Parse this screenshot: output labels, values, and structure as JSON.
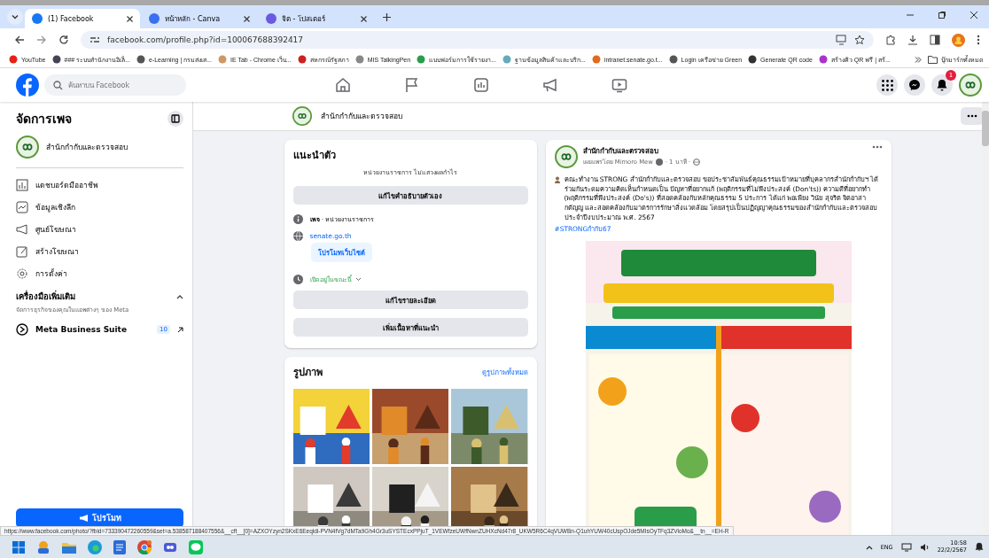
{
  "browser": {
    "tabs": [
      {
        "label": "(1) Facebook",
        "selected": true
      },
      {
        "label": "หน้าหลัก - Canva",
        "selected": false
      },
      {
        "label": "จิต - โปสเตอร์",
        "selected": false
      }
    ],
    "address": "facebook.com/profile.php?id=100067688392417",
    "bookmarks": [
      "YouTube",
      "### ระบบสำนักงานอิเล็...",
      "e-Learning | กรมส่งเส...",
      "IE Tab - Chrome เว็บ...",
      "สหกรณ์รัฐสภา",
      "MIS TalkingPen",
      "แบบฟอร์มการใช้รายงา...",
      "ฐานข้อมูลสินค้าและบริก...",
      "intranet.senate.go.t...",
      "Login เครือข่าย Green",
      "Generate QR code",
      "สร้างคิว QR ฟรี | สร้..."
    ],
    "all_bookmarks": "บุ๊กมาร์กทั้งหมด"
  },
  "header": {
    "search_placeholder": "ค้นหาบน Facebook",
    "notification_count": "1"
  },
  "sidebar": {
    "title": "จัดการเพจ",
    "page_name": "สำนักกำกับและตรวจสอบ",
    "items": [
      "แดชบอร์ดมืออาชีพ",
      "ข้อมูลเชิงลึก",
      "ศูนย์โฆษณา",
      "สร้างโฆษณา",
      "การตั้งค่า"
    ],
    "tools_title": "เครื่องมือเพิ่มเติม",
    "tools_subtitle": "จัดการธุรกิจของคุณในแอพต่างๆ ของ Meta",
    "tool": {
      "label": "Meta Business Suite",
      "count": "10"
    },
    "promote": "โปรโมท"
  },
  "page_header": {
    "name": "สำนักกำกับและตรวจสอบ"
  },
  "intro": {
    "title": "แนะนำตัว",
    "bio": "หน่วยงานราชการ ไม่แสวงผลกำไร",
    "edit_bio": "แก้ไขคำอธิบายตัวเอง",
    "category": "**เพจ** · หน่วยงานราชการ",
    "website": "senate.go.th",
    "promote_website": "โปรโมทเว็บไซต์",
    "hours": "เปิดอยู่ในขณะนี้",
    "edit_details": "แก้ไขรายละเอียด",
    "add_featured": "เพิ่มเนื้อหาที่แนะนำ"
  },
  "photos": {
    "title": "รูปภาพ",
    "see_all": "ดูรูปภาพทั้งหมด"
  },
  "post": {
    "author": "สำนักกำกับและตรวจสอบ",
    "byline": "เผยแพร่โดย Mimoro Mew",
    "time": "· 1 นาที ·",
    "text": "คณะทำงาน STRONG สำนักกำกับและตรวจสอบ ขอประชาสัมพันธ์คุณธรรมเป้าหมายที่บุคลากรสำนักกำกับฯ ได้ร่วมกันระดมความคิดเห็นกำหนดเป็น ปัญหาที่อยากแก้ (พฤติกรรมที่ไม่พึงประสงค์ (Don'ts)) ความดีที่อยากทำ (พฤติกรรมที่พึงประสงค์ (Do's)) ที่สอดคล้องกับหลักคุณธรรม 5 ประการ ได้แก่ พอเพียง วินัย สุจริต จิตอาสา กตัญญู และสอดคล้องกับมาตรการรักษาสิ่งแวดล้อม โดยสรุปเป็นปฏิญญาคุณธรรมของสำนักกำกับและตรวจสอบ ประจำปีงบประมาณ พ.ศ. 2567",
    "hashtag": "#STRONGกำกับ67"
  },
  "status_url": "https://www.facebook.com/photo/?fbid=733390472260559&set=a.538587188407556&__cft__[0]=AZXOYzyn2SKxE6Eeqldi-PVN4fVg7dMTa9Gh4Gr3uSYSTEcxPPjuT_1VEWfzeUWfNwnZUHXcNd47r8_UKW5R6C4qVUWBn-Q1uhYUW40cUspOJde5MIsOyTFq3ZVioMo&__tn__=EH-R",
  "taskbar": {
    "language": "ENG",
    "time": "10:58",
    "date": "22/2/2567"
  }
}
